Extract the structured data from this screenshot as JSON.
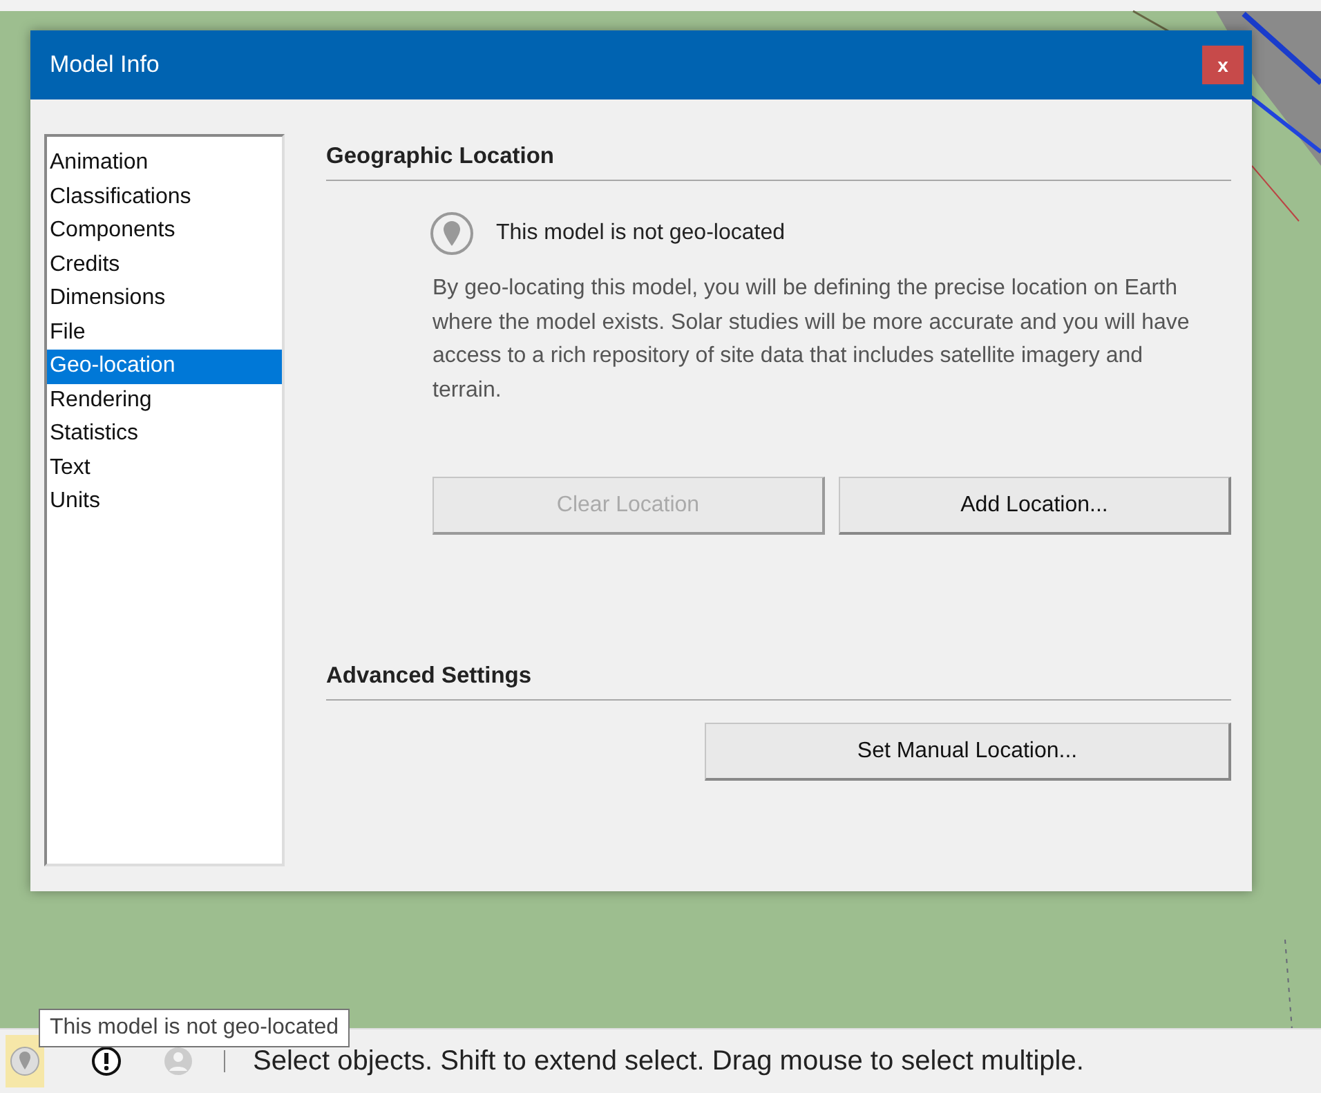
{
  "window": {
    "title": "Model Info",
    "close": "x"
  },
  "sidebar": {
    "items": [
      {
        "label": "Animation",
        "selected": false
      },
      {
        "label": "Classifications",
        "selected": false
      },
      {
        "label": "Components",
        "selected": false
      },
      {
        "label": "Credits",
        "selected": false
      },
      {
        "label": "Dimensions",
        "selected": false
      },
      {
        "label": "File",
        "selected": false
      },
      {
        "label": "Geo-location",
        "selected": true
      },
      {
        "label": "Rendering",
        "selected": false
      },
      {
        "label": "Statistics",
        "selected": false
      },
      {
        "label": "Text",
        "selected": false
      },
      {
        "label": "Units",
        "selected": false
      }
    ]
  },
  "geographic_location": {
    "heading": "Geographic Location",
    "status": "This model is not geo-located",
    "description": "By geo-locating this model, you will be defining the precise location on Earth where the model exists. Solar studies will be more accurate and you will have access to a rich repository of site data that includes satellite imagery and terrain.",
    "buttons": [
      {
        "label": "Clear Location",
        "disabled": true
      },
      {
        "label": "Add Location...",
        "disabled": false
      }
    ]
  },
  "advanced_settings": {
    "heading": "Advanced Settings",
    "buttons": [
      {
        "label": "Set Manual Location...",
        "disabled": false
      }
    ]
  },
  "tooltip": "This model is not geo-located",
  "status_bar": {
    "message": "Select objects. Shift to extend select. Drag mouse to select multiple."
  }
}
